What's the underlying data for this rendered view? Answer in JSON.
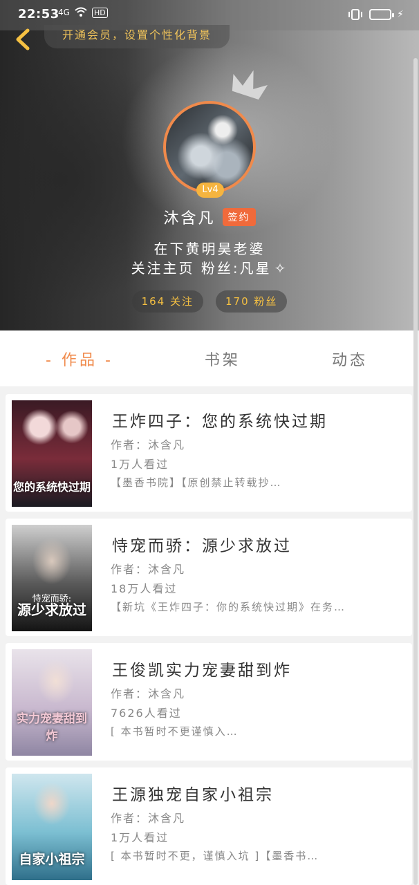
{
  "status_bar": {
    "time": "22:53",
    "network": "4G",
    "hd": "HD"
  },
  "header": {
    "vip_banner": "开通会员，设置个性化背景",
    "level": "Lv4",
    "username": "沐含凡",
    "sign_badge": "签约",
    "bio_line1": "在下黄明昊老婆",
    "bio_line2": "关注主页 粉丝:凡星",
    "following": "164 关注",
    "followers": "170 粉丝"
  },
  "tabs": [
    {
      "label": "- 作品 -",
      "active": true
    },
    {
      "label": "书架",
      "active": false
    },
    {
      "label": "动态",
      "active": false
    }
  ],
  "books": [
    {
      "title": "王炸四子：您的系统快过期",
      "author": "作者：沐含凡",
      "views": "1万人看过",
      "desc": "【墨香书院】【原创禁止转载抄…",
      "cover_text": "您的系统快过期",
      "cover_colors": [
        "#3a1a24",
        "#7a2c3a",
        "#1b1b22"
      ]
    },
    {
      "title": "恃宠而骄：源少求放过",
      "author": "作者：沐含凡",
      "views": "18万人看过",
      "desc": "【新坑《王炸四子：你的系统快过期》在务…",
      "cover_text": "源少求放过",
      "cover_sub": "恃宠而骄:",
      "cover_colors": [
        "#cfcfcf",
        "#5a5a5a",
        "#141414"
      ]
    },
    {
      "title": "王俊凯实力宠妻甜到炸",
      "author": "作者：沐含凡",
      "views": "7626人看过",
      "desc": "[ 本书暂时不更谨慎入…",
      "cover_text": "实力宠妻甜到炸",
      "cover_colors": [
        "#e9e3ea",
        "#c9b9cf",
        "#8f86a3"
      ]
    },
    {
      "title": "王源独宠自家小祖宗",
      "author": "作者：沐含凡",
      "views": "1万人看过",
      "desc": "[ 本书暂时不更，谨慎入坑 ]【墨香书…",
      "cover_text": "自家小祖宗",
      "cover_colors": [
        "#cfe6ee",
        "#7cbfd2",
        "#2f6f8a"
      ]
    }
  ]
}
